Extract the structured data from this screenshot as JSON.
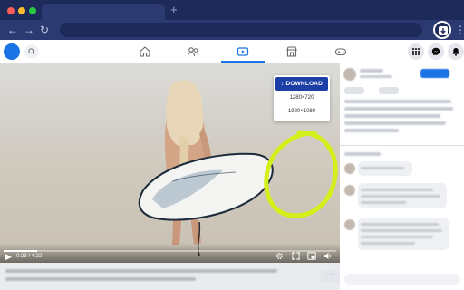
{
  "browser": {
    "new_tab_symbol": "+",
    "back_symbol": "←",
    "forward_symbol": "→",
    "reload_symbol": "↻",
    "menu_symbol": "⋮",
    "extension_icon": "download-arrow-icon",
    "colors": {
      "chrome_bg": "#1e2a5a",
      "toolbar_bg": "#2c3a72"
    }
  },
  "header": {
    "nav_icons": [
      "home-icon",
      "friends-icon",
      "watch-icon",
      "marketplace-icon",
      "gaming-icon"
    ],
    "active_nav": "watch-icon",
    "right_icons": [
      "grid-menu-icon",
      "messenger-icon",
      "notifications-icon"
    ],
    "colors": {
      "accent": "#1b74e4"
    }
  },
  "video": {
    "time_label": "0:23 / 4:22",
    "progress_fraction": 0.1,
    "controls": [
      "play-icon",
      "settings-icon",
      "fullscreen-icon",
      "pip-icon",
      "volume-icon"
    ]
  },
  "download_popup": {
    "button_label": "DOWNLOAD",
    "options": [
      "1280×720",
      "1920×1080"
    ],
    "colors": {
      "button": "#1b3fa6",
      "highlight_ring": "#d4f01a"
    }
  },
  "more_button_label": "···"
}
